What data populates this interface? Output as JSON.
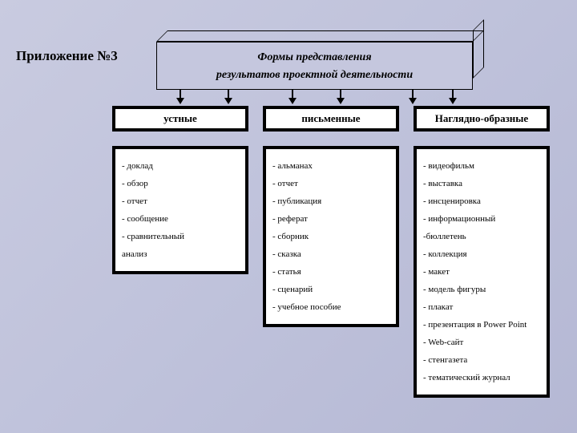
{
  "page_title": "Приложение №3",
  "banner": {
    "line1": "Формы представления",
    "line2": "результатов проектной деятельности"
  },
  "columns": [
    {
      "header": "устные",
      "items": [
        "- доклад",
        "- обзор",
        "- отчет",
        "- сообщение",
        "- сравнительный",
        "анализ"
      ]
    },
    {
      "header": "письменные",
      "items": [
        "- альманах",
        "- отчет",
        "- публикация",
        "- реферат",
        "- сборник",
        "- сказка",
        "- статья",
        "- сценарий",
        "- учебное пособие"
      ]
    },
    {
      "header": "Наглядно-образные",
      "items": [
        "- видеофильм",
        "- выставка",
        "- инсценировка",
        "- информационный",
        "-бюллетень",
        "- коллекция",
        "- макет",
        "- модель фигуры",
        "- плакат",
        "- презентация в Power Point",
        "- Web-сайт",
        "- стенгазета",
        "- тематический журнал"
      ]
    }
  ]
}
